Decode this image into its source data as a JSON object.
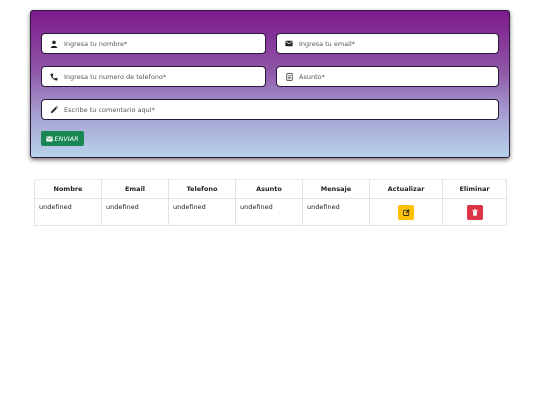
{
  "form": {
    "name_placeholder": "Ingresa tu nombre*",
    "email_placeholder": "Ingresa tu email*",
    "phone_placeholder": "Ingresa tu numero de telefono*",
    "subject_placeholder": "Asunto*",
    "comment_placeholder": "Escribe tu comentario aqui*",
    "send_label": "ENVIAR"
  },
  "table": {
    "headers": [
      "Nombre",
      "Email",
      "Telefono",
      "Asunto",
      "Mensaje",
      "Actualizar",
      "Eliminar"
    ],
    "rows": [
      [
        "undefined",
        "undefined",
        "undefined",
        "undefined",
        "undefined"
      ]
    ]
  },
  "colors": {
    "gradient_top": "#7d1a8c",
    "gradient_bottom": "#b7d3ea",
    "send_button": "#198754",
    "edit_button": "#ffc107",
    "delete_button": "#dc3545"
  },
  "icons": {
    "name_field": "user-icon",
    "email_field": "envelope-icon",
    "phone_field": "phone-icon",
    "subject_field": "document-icon",
    "comment_field": "pencil-icon",
    "send_button": "envelope-icon",
    "edit_button": "edit-icon",
    "delete_button": "trash-icon"
  }
}
